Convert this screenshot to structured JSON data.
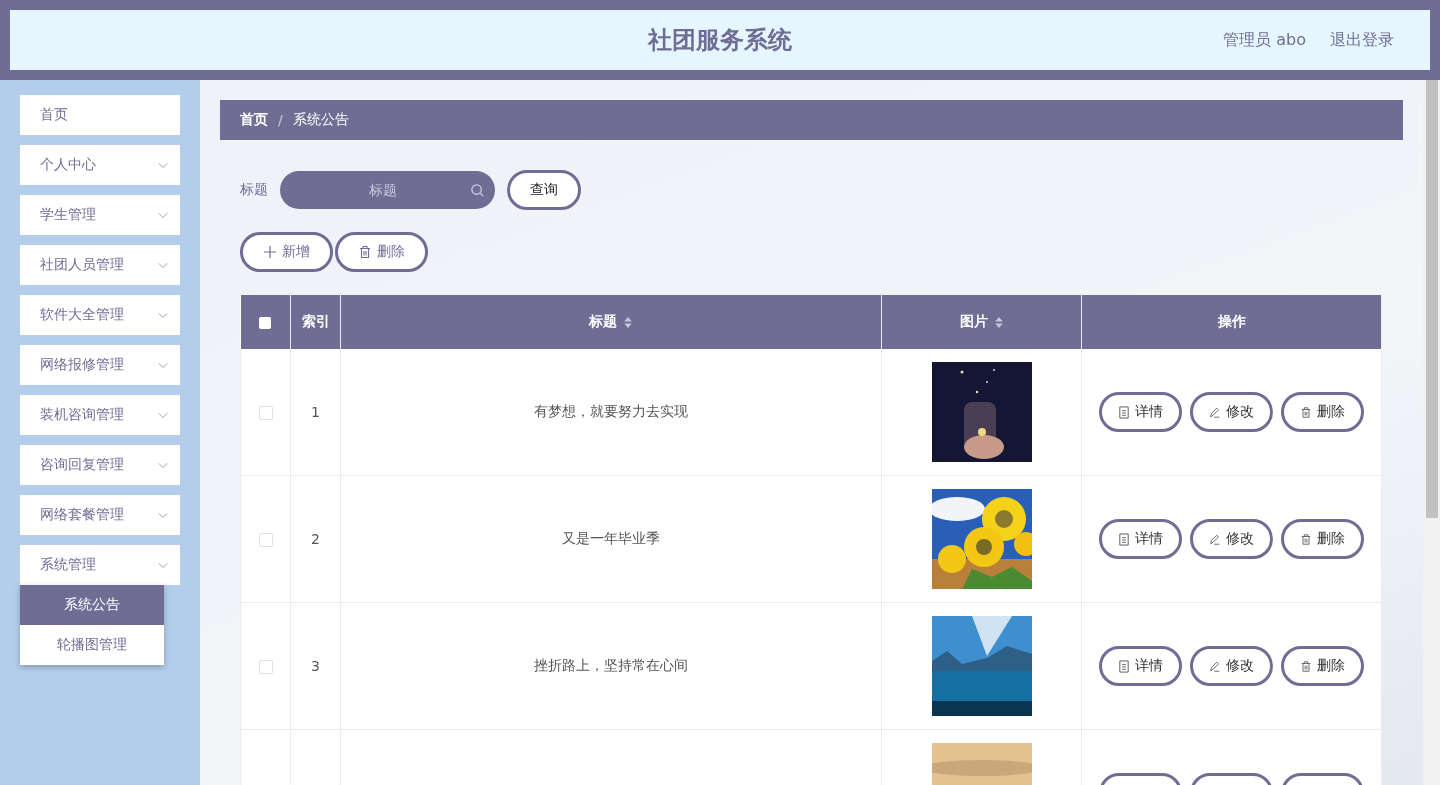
{
  "header": {
    "title": "社团服务系统",
    "user": "管理员 abo",
    "logout": "退出登录"
  },
  "sidebar": {
    "items": [
      {
        "label": "首页",
        "expandable": false
      },
      {
        "label": "个人中心",
        "expandable": true,
        "expanded": false
      },
      {
        "label": "学生管理",
        "expandable": true,
        "expanded": false
      },
      {
        "label": "社团人员管理",
        "expandable": true,
        "expanded": false
      },
      {
        "label": "软件大全管理",
        "expandable": true,
        "expanded": false
      },
      {
        "label": "网络报修管理",
        "expandable": true,
        "expanded": false
      },
      {
        "label": "装机咨询管理",
        "expandable": true,
        "expanded": false
      },
      {
        "label": "咨询回复管理",
        "expandable": true,
        "expanded": false
      },
      {
        "label": "网络套餐管理",
        "expandable": true,
        "expanded": false
      },
      {
        "label": "系统管理",
        "expandable": true,
        "expanded": true,
        "children": [
          {
            "label": "系统公告",
            "selected": true
          },
          {
            "label": "轮播图管理",
            "selected": false
          }
        ]
      }
    ]
  },
  "breadcrumb": {
    "separator": "/",
    "items": [
      "首页",
      "系统公告"
    ]
  },
  "search": {
    "label": "标题",
    "placeholder": "标题",
    "button": "查询"
  },
  "toolbar": [
    {
      "kind": "add",
      "label": "新增"
    },
    {
      "kind": "delete",
      "label": "删除"
    }
  ],
  "table": {
    "columns": [
      {
        "kind": "checkbox",
        "checked": false
      },
      {
        "kind": "text",
        "label": "索引",
        "sortable": false
      },
      {
        "kind": "text",
        "label": "标题",
        "sortable": true
      },
      {
        "kind": "text",
        "label": "图片",
        "sortable": true
      },
      {
        "kind": "text",
        "label": "操作",
        "sortable": false
      }
    ],
    "rows": [
      {
        "checked": false,
        "index": "1",
        "title": "有梦想，就要努力去实现",
        "actions": [
          {
            "kind": "detail",
            "label": "详情"
          },
          {
            "kind": "edit",
            "label": "修改"
          },
          {
            "kind": "delete",
            "label": "删除"
          }
        ]
      },
      {
        "checked": false,
        "index": "2",
        "title": "又是一年毕业季",
        "actions": [
          {
            "kind": "detail",
            "label": "详情"
          },
          {
            "kind": "edit",
            "label": "修改"
          },
          {
            "kind": "delete",
            "label": "删除"
          }
        ]
      },
      {
        "checked": false,
        "index": "3",
        "title": "挫折路上，坚持常在心间",
        "actions": [
          {
            "kind": "detail",
            "label": "详情"
          },
          {
            "kind": "edit",
            "label": "修改"
          },
          {
            "kind": "delete",
            "label": "删除"
          }
        ]
      },
      {
        "actions": [
          {
            "kind": "detail"
          },
          {
            "kind": "edit"
          },
          {
            "kind": "delete"
          }
        ]
      }
    ]
  }
}
